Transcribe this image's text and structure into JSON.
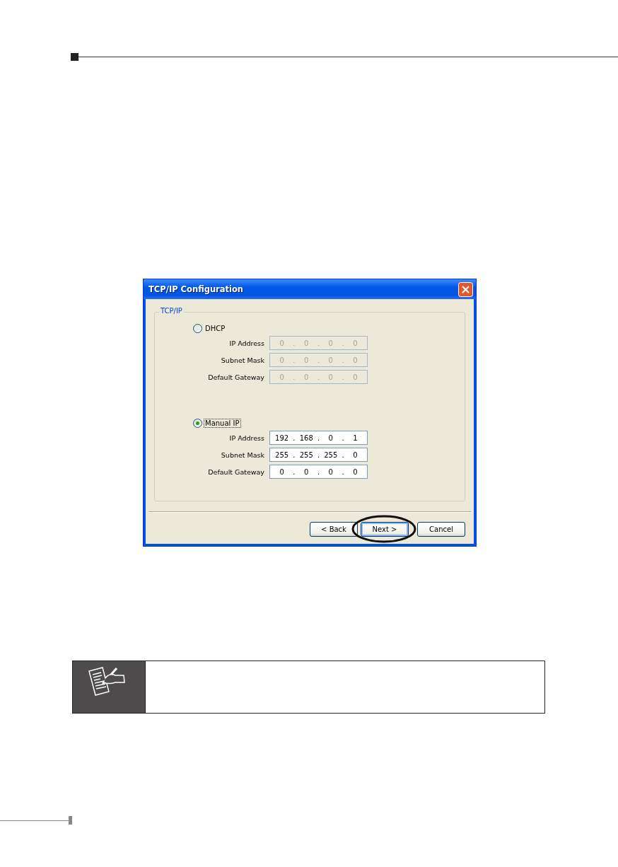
{
  "window": {
    "title": "TCP/IP Configuration"
  },
  "group": {
    "title": "TCP/IP",
    "separator": "."
  },
  "modes": [
    {
      "label": "DHCP",
      "selected": false,
      "focused": false,
      "fields": [
        {
          "label": "IP Address",
          "disabled": true,
          "octets": [
            "0",
            "0",
            "0",
            "0"
          ]
        },
        {
          "label": "Subnet Mask",
          "disabled": true,
          "octets": [
            "0",
            "0",
            "0",
            "0"
          ]
        },
        {
          "label": "Default Gateway",
          "disabled": true,
          "octets": [
            "0",
            "0",
            "0",
            "0"
          ]
        }
      ]
    },
    {
      "label": "Manual IP",
      "selected": true,
      "focused": true,
      "fields": [
        {
          "label": "IP Address",
          "disabled": false,
          "octets": [
            "192",
            "168",
            "0",
            "1"
          ]
        },
        {
          "label": "Subnet Mask",
          "disabled": false,
          "octets": [
            "255",
            "255",
            "255",
            "0"
          ]
        },
        {
          "label": "Default Gateway",
          "disabled": false,
          "octets": [
            "0",
            "0",
            "0",
            "0"
          ]
        }
      ]
    }
  ],
  "buttons": [
    {
      "label": "< Back",
      "focused": false,
      "circled": false
    },
    {
      "label": "Next >",
      "focused": true,
      "circled": true
    },
    {
      "label": "Cancel",
      "focused": false,
      "circled": false
    }
  ]
}
